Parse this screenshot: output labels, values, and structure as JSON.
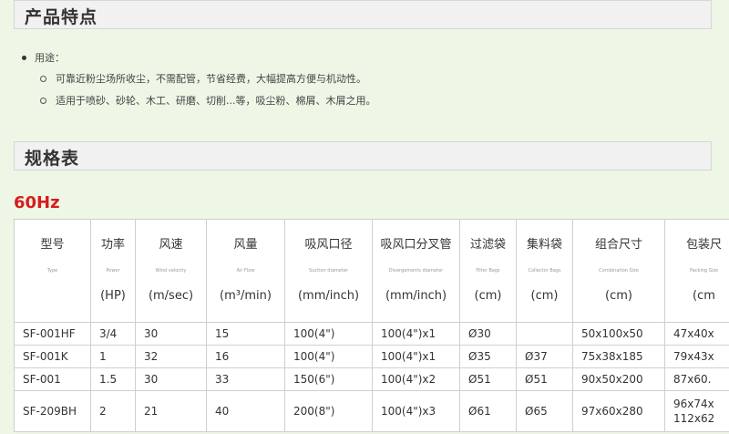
{
  "features": {
    "title": "产品特点",
    "usage_label": "用途：",
    "items": [
      "可靠近粉尘场所收尘，不需配管，节省经费，大幅提高方便与机动性。",
      "适用于喷砂、砂轮、木工、研磨、切削...等，吸尘粉、棉屑、木屑之用。"
    ]
  },
  "spec": {
    "title": "规格表",
    "frequency": "60Hz"
  },
  "table": {
    "headers": [
      {
        "zh": "型号",
        "en": "Type",
        "unit": ""
      },
      {
        "zh": "功率",
        "en": "Power",
        "unit": "(HP)"
      },
      {
        "zh": "风速",
        "en": "Wind velocity",
        "unit": "(m/sec)"
      },
      {
        "zh": "风量",
        "en": "Air Flow",
        "unit": "(m³/min)"
      },
      {
        "zh": "吸风口径",
        "en": "Suction diameter",
        "unit": "(mm/inch)"
      },
      {
        "zh": "吸风口分叉管",
        "en": "Divergements diameter",
        "unit": "(mm/inch)"
      },
      {
        "zh": "过滤袋",
        "en": "Filter Bags",
        "unit": "(cm)"
      },
      {
        "zh": "集料袋",
        "en": "Collector Bags",
        "unit": "(cm)"
      },
      {
        "zh": "组合尺寸",
        "en": "Combination Size",
        "unit": "(cm)"
      },
      {
        "zh": "包装尺",
        "en": "Packing Size",
        "unit": "(cm"
      }
    ],
    "rows": [
      [
        "SF-001HF",
        "3/4",
        "30",
        "15",
        "100(4\")",
        "100(4\")x1",
        "Ø30",
        "",
        "50x100x50",
        "47x40x"
      ],
      [
        "SF-001K",
        "1",
        "32",
        "16",
        "100(4\")",
        "100(4\")x1",
        "Ø35",
        "Ø37",
        "75x38x185",
        "79x43x"
      ],
      [
        "SF-001",
        "1.5",
        "30",
        "33",
        "150(6\")",
        "100(4\")x2",
        "Ø51",
        "Ø51",
        "90x50x200",
        "87x60."
      ],
      [
        "SF-209BH",
        "2",
        "21",
        "40",
        "200(8\")",
        "100(4\")x3",
        "Ø61",
        "Ø65",
        "97x60x280",
        "96x74x 112x62"
      ]
    ]
  }
}
